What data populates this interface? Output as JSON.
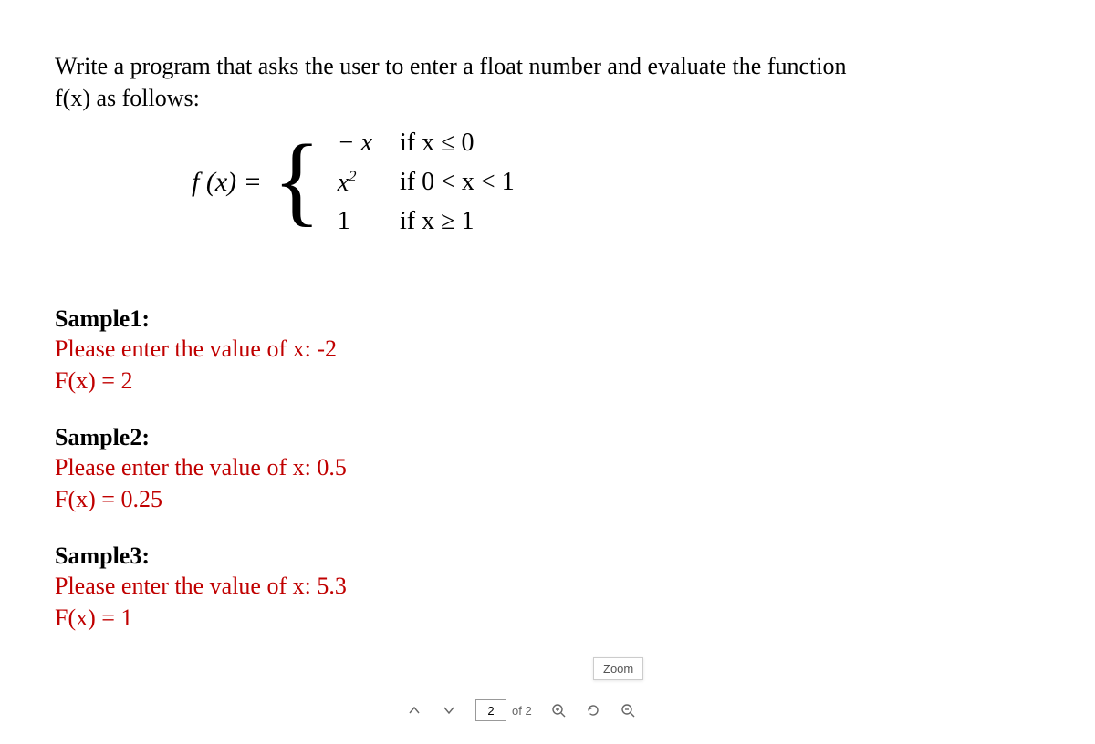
{
  "intro_line1": "Write a program that asks the user to enter a float number and evaluate the function",
  "intro_line2": "f(x) as follows:",
  "formula": {
    "lhs": "f (x) = ",
    "cases": [
      {
        "expr": "− x",
        "cond": "if  x ≤ 0"
      },
      {
        "expr": "x²",
        "cond": "if  0 < x < 1"
      },
      {
        "expr": "1",
        "cond": "if  x ≥ 1"
      }
    ]
  },
  "samples": [
    {
      "title": "Sample1:",
      "line1": "Please enter the value of x: -2",
      "line2": "F(x) = 2"
    },
    {
      "title": "Sample2:",
      "line1": "Please enter the value of x: 0.5",
      "line2": "F(x) = 0.25"
    },
    {
      "title": "Sample3:",
      "line1": "Please enter the value of x: 5.3",
      "line2": "F(x) = 1"
    }
  ],
  "toolbar": {
    "page": "2",
    "page_total": "of 2",
    "tooltip": "Zoom"
  }
}
